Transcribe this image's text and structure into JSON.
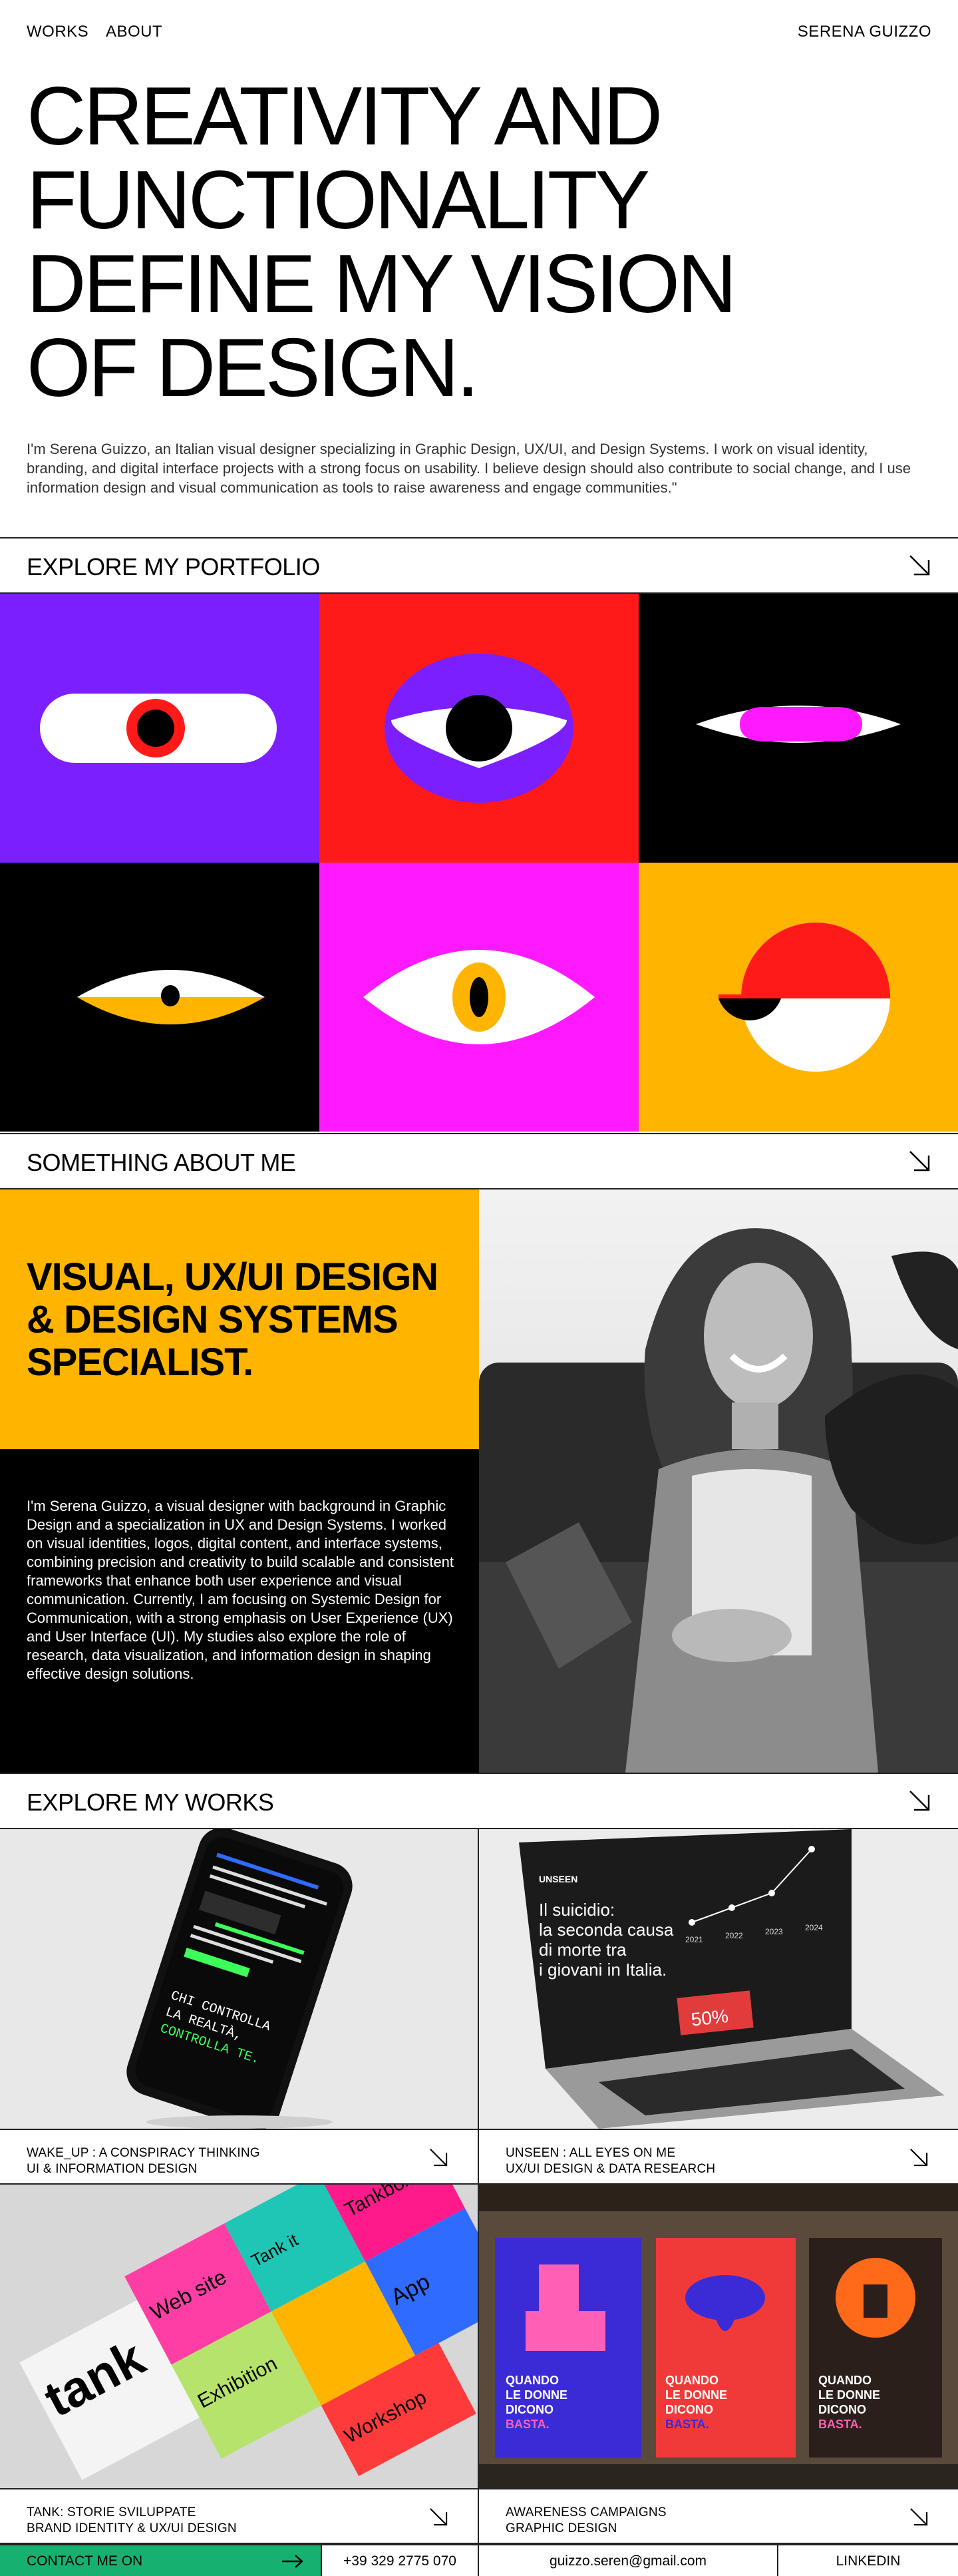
{
  "nav": {
    "works": "WORKS",
    "about": "ABOUT",
    "name": "SERENA GUIZZO"
  },
  "hero": {
    "lines": [
      "CREATIVITY AND",
      "FUNCTIONALITY",
      "DEFINE MY VISION",
      "OF DESIGN."
    ],
    "intro": "I'm Serena Guizzo, an Italian visual designer specializing in Graphic Design, UX/UI, and Design Systems. I work on visual identity, branding, and digital interface projects with a strong focus on usability. I believe design should also contribute to social change, and I use information design and visual communication as tools to raise awareness and engage communities.\""
  },
  "sections": {
    "portfolio": "EXPLORE MY PORTFOLIO",
    "about": "SOMETHING ABOUT ME",
    "works": "EXPLORE MY WORKS"
  },
  "portfolio_tiles": [
    {
      "bg": "#7b1fff",
      "icon": "eye-pill-icon"
    },
    {
      "bg": "#ff1a1a",
      "icon": "eye-circle-icon"
    },
    {
      "bg": "#000000",
      "icon": "eye-slit-icon"
    },
    {
      "bg": "#000000",
      "icon": "eye-half-icon"
    },
    {
      "bg": "#ff19ff",
      "icon": "eye-almond-icon"
    },
    {
      "bg": "#ffb400",
      "icon": "eye-ball-icon"
    }
  ],
  "about": {
    "heading": [
      "VISUAL, UX/UI DESIGN",
      "& DESIGN SYSTEMS",
      "SPECIALIST."
    ],
    "text": "I'm Serena Guizzo, a visual designer with background in Graphic Design and a specialization in UX and Design Systems. I worked on visual identities, logos, digital content, and interface systems, combining precision and creativity to build scalable and consistent frameworks that enhance both user experience and visual communication. Currently, I am focusing on Systemic Design for Communication, with a strong emphasis on User Experience (UX) and User Interface (UI). My studies also explore the role of research, data visualization, and information design in shaping effective design solutions."
  },
  "works": [
    {
      "title": "WAKE_UP : A CONSPIRACY THINKING",
      "subtitle": "UI & INFORMATION DESIGN"
    },
    {
      "title": "UNSEEN : ALL EYES ON ME",
      "subtitle": "UX/UI DESIGN & DATA RESEARCH"
    },
    {
      "title": "TANK: STORIE SVILUPPATE",
      "subtitle": "BRAND IDENTITY & UX/UI DESIGN"
    },
    {
      "title": "AWARENESS CAMPAIGNS",
      "subtitle": "GRAPHIC DESIGN"
    }
  ],
  "mockups": {
    "phone_screen": [
      "CHI CONTROLLA",
      "LA REALTÀ,",
      "CONTROLLA TE."
    ],
    "laptop_brand": "UNSEEN",
    "laptop_headline": [
      "Il suicidio:",
      "la seconda causa",
      "di morte tra",
      "i giovani in Italia."
    ],
    "laptop_percent": "50%",
    "laptop_years": [
      "2021",
      "2022",
      "2023",
      "2024"
    ],
    "tank_word": "tank",
    "tank_cards": [
      "Web site",
      "Tank it",
      "Tankbox",
      "Exhibition",
      "App",
      "Workshop"
    ],
    "poster_lines": [
      "QUANDO",
      "LE DONNE",
      "DICONO",
      "BASTA."
    ]
  },
  "footer": {
    "contact": "CONTACT ME ON",
    "phone": "+39 329 2775 070",
    "email": "guizzo.seren@gmail.com",
    "linkedin": "LINKEDIN"
  },
  "colors": {
    "purple": "#7b1fff",
    "red": "#ff1a1a",
    "magenta": "#ff19ff",
    "yellow": "#ffb400",
    "green": "#16b170"
  }
}
